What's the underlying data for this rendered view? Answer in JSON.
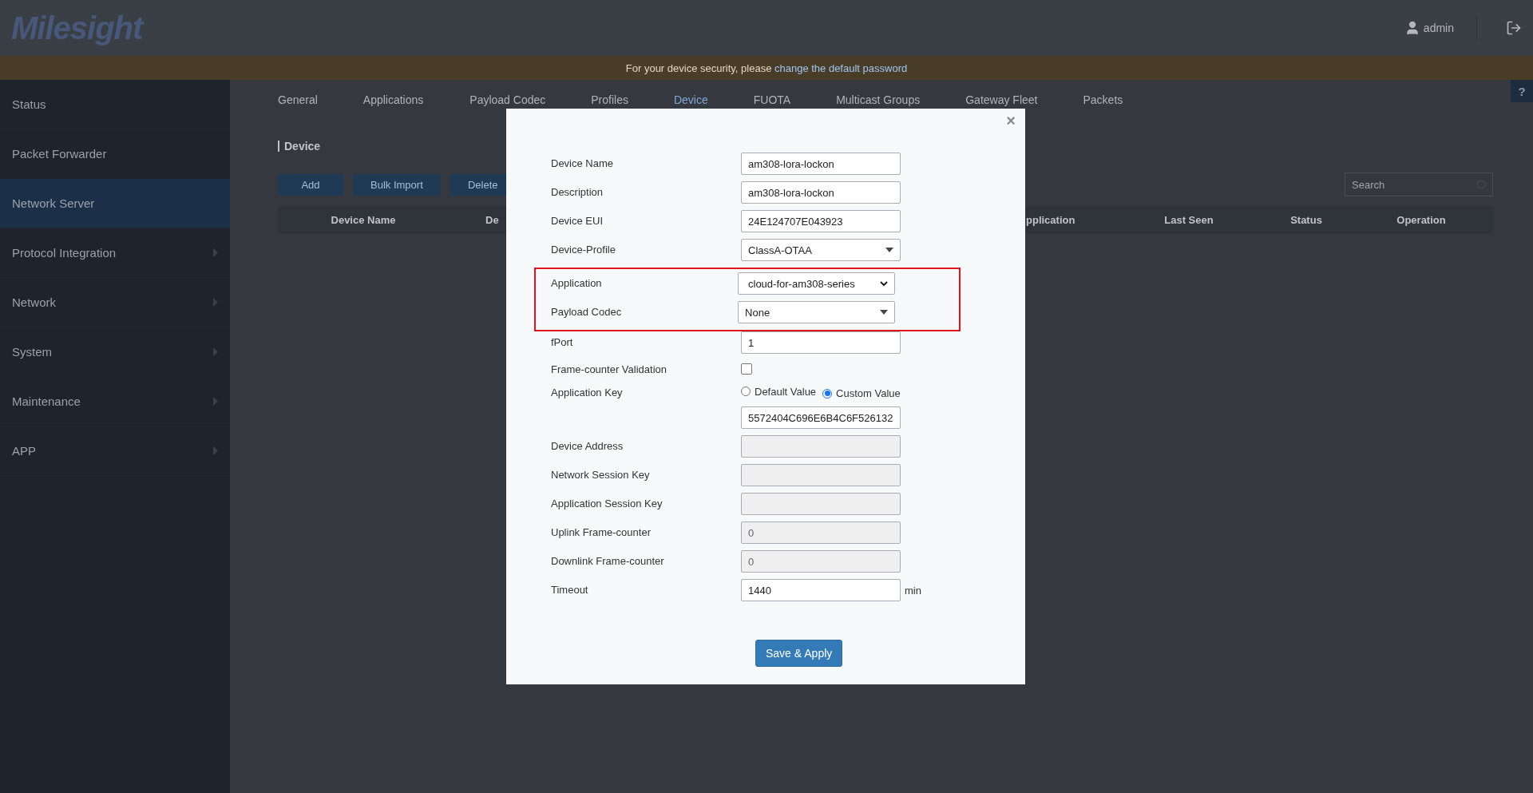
{
  "header": {
    "logo": "Milesight",
    "user": "admin"
  },
  "banner": {
    "text": "For your device security, please ",
    "link": "change the default password"
  },
  "sidebar": {
    "items": [
      {
        "label": "Status",
        "selected": false,
        "expandable": false
      },
      {
        "label": "Packet Forwarder",
        "selected": false,
        "expandable": false
      },
      {
        "label": "Network Server",
        "selected": true,
        "expandable": false
      },
      {
        "label": "Protocol Integration",
        "selected": false,
        "expandable": true
      },
      {
        "label": "Network",
        "selected": false,
        "expandable": true
      },
      {
        "label": "System",
        "selected": false,
        "expandable": true
      },
      {
        "label": "Maintenance",
        "selected": false,
        "expandable": true
      },
      {
        "label": "APP",
        "selected": false,
        "expandable": true
      }
    ]
  },
  "tabs": [
    {
      "label": "General",
      "selected": false
    },
    {
      "label": "Applications",
      "selected": false
    },
    {
      "label": "Payload Codec",
      "selected": false
    },
    {
      "label": "Profiles",
      "selected": false
    },
    {
      "label": "Device",
      "selected": true
    },
    {
      "label": "FUOTA",
      "selected": false
    },
    {
      "label": "Multicast Groups",
      "selected": false
    },
    {
      "label": "Gateway Fleet",
      "selected": false
    },
    {
      "label": "Packets",
      "selected": false
    }
  ],
  "help": "?",
  "section_title": "Device",
  "toolbar": {
    "buttons": [
      "Add",
      "Bulk Import",
      "Delete"
    ],
    "search": {
      "placeholder": "Search"
    }
  },
  "table": {
    "columns": [
      "Device Name",
      "De",
      "pplication",
      "Last Seen",
      "Status",
      "Operation"
    ]
  },
  "modal": {
    "close": "×",
    "fields": [
      {
        "kind": "text",
        "label": "Device Name",
        "value": "am308-lora-lockon",
        "highlighted": false
      },
      {
        "kind": "text",
        "label": "Description",
        "value": "am308-lora-lockon",
        "highlighted": false
      },
      {
        "kind": "text",
        "label": "Device EUI",
        "value": "24E124707E043923",
        "highlighted": false
      },
      {
        "kind": "select",
        "label": "Device-Profile",
        "value": "ClassA-OTAA",
        "highlighted": false
      },
      {
        "kind": "native_select",
        "label": "Application",
        "value": "cloud-for-am308-series",
        "highlighted": true
      },
      {
        "kind": "select",
        "label": "Payload Codec",
        "value": "None",
        "highlighted": true
      },
      {
        "kind": "text",
        "label": "fPort",
        "value": "1",
        "highlighted": false
      },
      {
        "kind": "checkbox",
        "label": "Frame-counter Validation",
        "checked": false,
        "highlighted": false
      },
      {
        "kind": "radio",
        "label": "Application Key",
        "options": [
          {
            "label": "Default Value",
            "selected": false
          },
          {
            "label": "Custom Value",
            "selected": true
          }
        ],
        "highlighted": false
      },
      {
        "kind": "text",
        "value": "5572404C696E6B4C6F526132",
        "highlighted": false
      },
      {
        "kind": "text",
        "label": "Device Address",
        "disabled": true,
        "highlighted": false
      },
      {
        "kind": "text",
        "label": "Network Session Key",
        "disabled": true,
        "highlighted": false
      },
      {
        "kind": "text",
        "label": "Application Session Key",
        "disabled": true,
        "highlighted": false
      },
      {
        "kind": "text",
        "label": "Uplink Frame-counter",
        "value": "0",
        "disabled": true,
        "highlighted": false
      },
      {
        "kind": "text",
        "label": "Downlink Frame-counter",
        "value": "0",
        "disabled": true,
        "highlighted": false
      },
      {
        "kind": "text",
        "label": "Timeout",
        "value": "1440",
        "unit": "min",
        "highlighted": false
      }
    ],
    "save": "Save & Apply"
  }
}
